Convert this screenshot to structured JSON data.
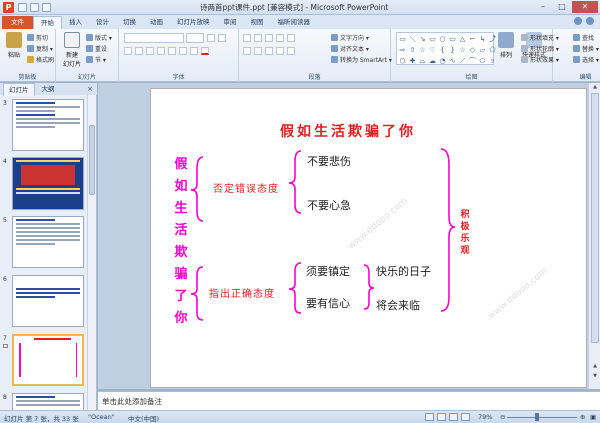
{
  "window": {
    "title": "诗两首ppt课件.ppt [兼容模式] - Microsoft PowerPoint",
    "app_icon": "P"
  },
  "tabs": [
    "文件",
    "开始",
    "插入",
    "设计",
    "切换",
    "动画",
    "幻灯片放映",
    "审阅",
    "视图",
    "福昕阅读器"
  ],
  "ribbon": {
    "clipboard": {
      "label": "剪贴板",
      "paste": "粘贴",
      "cut": "剪切",
      "copy": "复制 ▾",
      "format_painter": "格式刷"
    },
    "slides": {
      "label": "幻灯片",
      "new_slide": "新建\n幻灯片",
      "layout": "版式 ▾",
      "reset": "重设",
      "section": "节 ▾"
    },
    "font": {
      "label": "字体"
    },
    "paragraph": {
      "label": "段落",
      "text_direction": "文字方向 ▾",
      "align_text": "对齐文本 ▾",
      "smartart": "转换为 SmartArt ▾"
    },
    "drawing": {
      "label": "绘图",
      "arrange": "排列",
      "quick_styles": "快速样式",
      "shape_fill": "形状填充 ▾",
      "shape_outline": "形状轮廓 ▾",
      "shape_effects": "形状效果 ▾"
    },
    "editing": {
      "label": "编辑",
      "find": "查找",
      "replace": "替换 ▾",
      "select": "选择 ▾"
    }
  },
  "panel": {
    "tabs": [
      "幻灯片",
      "大纲"
    ],
    "close": "×",
    "thumbnails": [
      {
        "num": "3"
      },
      {
        "num": "4"
      },
      {
        "num": "5"
      },
      {
        "num": "6"
      },
      {
        "num": "7"
      },
      {
        "num": "8"
      }
    ]
  },
  "slide": {
    "title": "假如生活欺骗了你",
    "vertical_title": [
      "假",
      "如",
      "生",
      "活",
      "欺",
      "骗",
      "了",
      "你"
    ],
    "attitude_a": "否定错误态度",
    "attitude_b": "指出正确态度",
    "item1": "不要悲伤",
    "item2": "不要心急",
    "item3": "须要镇定",
    "item4": "要有信心",
    "item5": "快乐的日子",
    "item6": "将会来临",
    "right_label": [
      "积",
      "极",
      "乐",
      "观"
    ],
    "watermark": "www.ddooo.com",
    "accent_pink": "#ff00cc",
    "accent_red": "#e02020"
  },
  "notes": {
    "placeholder": "单击此处添加备注"
  },
  "status": {
    "slide_info": "幻灯片 第 7 张，共 33 张",
    "theme": "\"Ocean\"",
    "language": "中文(中国)",
    "zoom": "79%"
  }
}
